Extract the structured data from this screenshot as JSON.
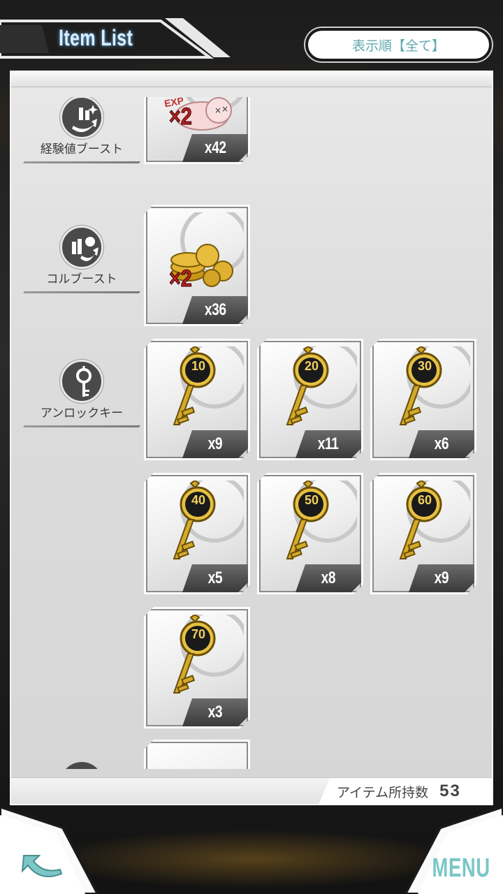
{
  "header": {
    "title": "Item List",
    "sort_label": "表示順【全て】"
  },
  "categories": [
    {
      "label": "経験値ブースト",
      "icon": "exp-boost-icon"
    },
    {
      "label": "コルブースト",
      "icon": "col-boost-icon"
    },
    {
      "label": "アンロックキー",
      "icon": "key-icon"
    }
  ],
  "items": {
    "exp_boost": [
      {
        "qty": "x42",
        "badge": "EXP",
        "mult": "×2"
      }
    ],
    "col_boost": [
      {
        "qty": "x36",
        "mult": "×2"
      }
    ],
    "keys": [
      {
        "num": "10",
        "qty": "x9"
      },
      {
        "num": "20",
        "qty": "x11"
      },
      {
        "num": "30",
        "qty": "x6"
      },
      {
        "num": "40",
        "qty": "x5"
      },
      {
        "num": "50",
        "qty": "x8"
      },
      {
        "num": "60",
        "qty": "x9"
      },
      {
        "num": "70",
        "qty": "x3"
      }
    ]
  },
  "footer": {
    "count_label": "アイテム所持数",
    "count_value": "53",
    "menu_label": "MENU"
  },
  "colors": {
    "accent_teal": "#7bc6c6",
    "sort_text": "#5fa8ae",
    "key_gold": "#d4aa2a",
    "panel_bg": "#dcdcdc"
  }
}
